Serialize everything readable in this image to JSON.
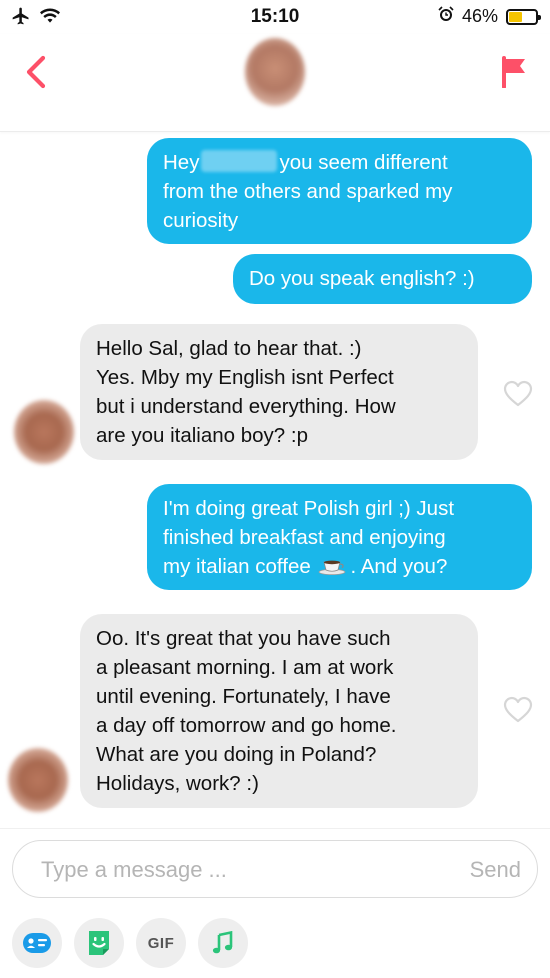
{
  "status_bar": {
    "time": "15:10",
    "battery": "46%",
    "battery_level": 0.46
  },
  "header": {
    "back": "back",
    "flag": "report"
  },
  "colors": {
    "accent": "#fd5068",
    "outgoing": "#1ab7ea",
    "incoming": "#ebebeb"
  },
  "messages": [
    {
      "direction": "outgoing",
      "lines": [
        "Hey",
        "you seem different",
        "from the others and sparked my",
        "curiosity"
      ]
    },
    {
      "direction": "outgoing",
      "text": "Do you speak english? :)"
    },
    {
      "direction": "incoming",
      "lines": [
        "Hello Sal, glad to hear that. :)",
        "Yes. Mby my English isnt Perfect",
        "but i understand everything. How",
        "are you italiano boy? :p"
      ]
    },
    {
      "direction": "outgoing",
      "lines": [
        "I'm doing great Polish girl ;) Just",
        "finished breakfast and enjoying",
        "my italian coffee",
        ". And you?"
      ]
    },
    {
      "direction": "incoming",
      "lines": [
        "Oo. It's great that you have such",
        "a pleasant morning. I am at work",
        "until evening. Fortunately, I have",
        "a day off tomorrow and go home.",
        "What are you doing in Poland?",
        "Holidays, work? :)"
      ]
    }
  ],
  "composer": {
    "placeholder": "Type a message ...",
    "send_label": "Send"
  },
  "toolbar": {
    "gif_label": "GIF"
  }
}
